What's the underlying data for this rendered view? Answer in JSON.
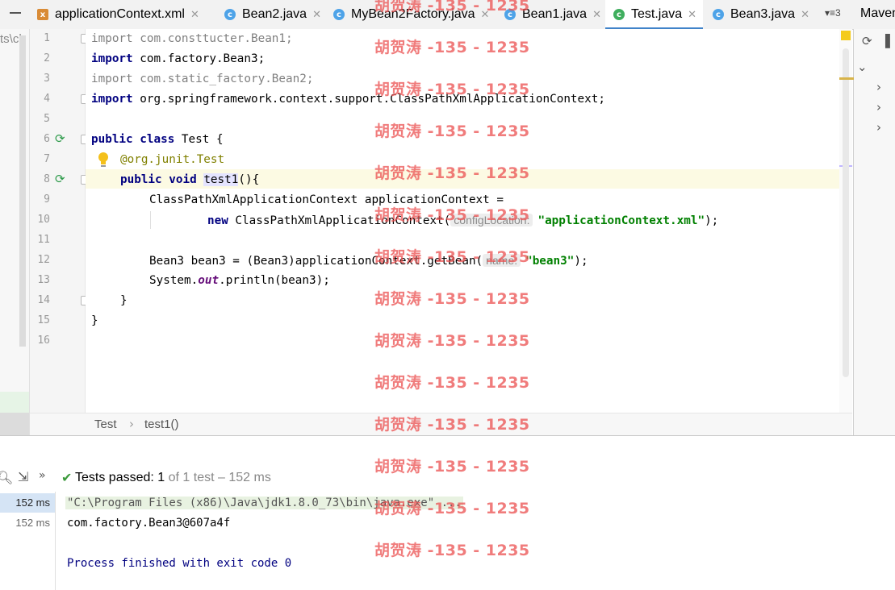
{
  "tabs": [
    {
      "label": "applicationContext.xml",
      "icon": "xml-file-icon",
      "active": false
    },
    {
      "label": "Bean2.java",
      "icon": "class-icon",
      "active": false
    },
    {
      "label": "MyBean2Factory.java",
      "icon": "class-icon",
      "active": false
    },
    {
      "label": "Bean1.java",
      "icon": "class-icon",
      "active": false
    },
    {
      "label": "Test.java",
      "icon": "test-class-icon",
      "active": true
    },
    {
      "label": "Bean3.java",
      "icon": "class-icon",
      "active": false
    }
  ],
  "tab_close": "✕",
  "tab_overflow": "▾≡3",
  "maven_title": "Maven",
  "project_path_fragment": "ts\\ch",
  "line_numbers": [
    "1",
    "2",
    "3",
    "4",
    "5",
    "6",
    "7",
    "8",
    "9",
    "10",
    "11",
    "12",
    "13",
    "14",
    "15",
    "16"
  ],
  "code": {
    "l1_kw": "import",
    "l1_rest": " com.consttucter.Bean1;",
    "l2_kw": "import",
    "l2_rest": " com.factory.Bean3;",
    "l3_kw": "import",
    "l3_rest": " com.static_factory.Bean2;",
    "l4_kw": "import",
    "l4_rest": " org.springframework.context.support.ClassPathXmlApplicationContext;",
    "l6_kw1": "public",
    "l6_kw2": "class",
    "l6_rest": " Test {",
    "l7_at": "@org.junit.",
    "l7_ann": "Test",
    "l8_kw1": "public",
    "l8_kw2": "void",
    "l8_method": "test1",
    "l8_rest": "(){",
    "l9": "ClassPathXmlApplicationContext applicationContext =",
    "l10_kw": "new",
    "l10_rest": " ClassPathXmlApplicationContext(",
    "l10_hint": "configLocation:",
    "l10_str": "\"applicationContext.xml\"",
    "l10_end": ");",
    "l12_rest": "Bean3 bean3 = (Bean3)applicationContext.getBean(",
    "l12_hint": "name:",
    "l12_str": "\"bean3\"",
    "l12_end": ");",
    "l13_a": "System.",
    "l13_static": "out",
    "l13_b": ".println(bean3);",
    "l14": "}",
    "l15": "}"
  },
  "breadcrumb": {
    "class": "Test",
    "separator": "›",
    "method": "test1()"
  },
  "run": {
    "status_prefix": "Tests passed: ",
    "status_count": "1",
    "status_suffix": " of 1 test – 152 ms",
    "tree": [
      "152 ms",
      "152 ms"
    ],
    "output": [
      "\"C:\\Program Files (x86)\\Java\\jdk1.8.0_73\\bin\\java.exe\" ...",
      "com.factory.Bean3@607a4f",
      "",
      "Process finished with exit code 0"
    ]
  },
  "watermark": "胡贺涛 -135 - 1235",
  "colors": {
    "keyword": "#000080",
    "string": "#008000",
    "annotation": "#808000",
    "pass": "#3c9a3c",
    "active_tab": "#4083c9"
  }
}
